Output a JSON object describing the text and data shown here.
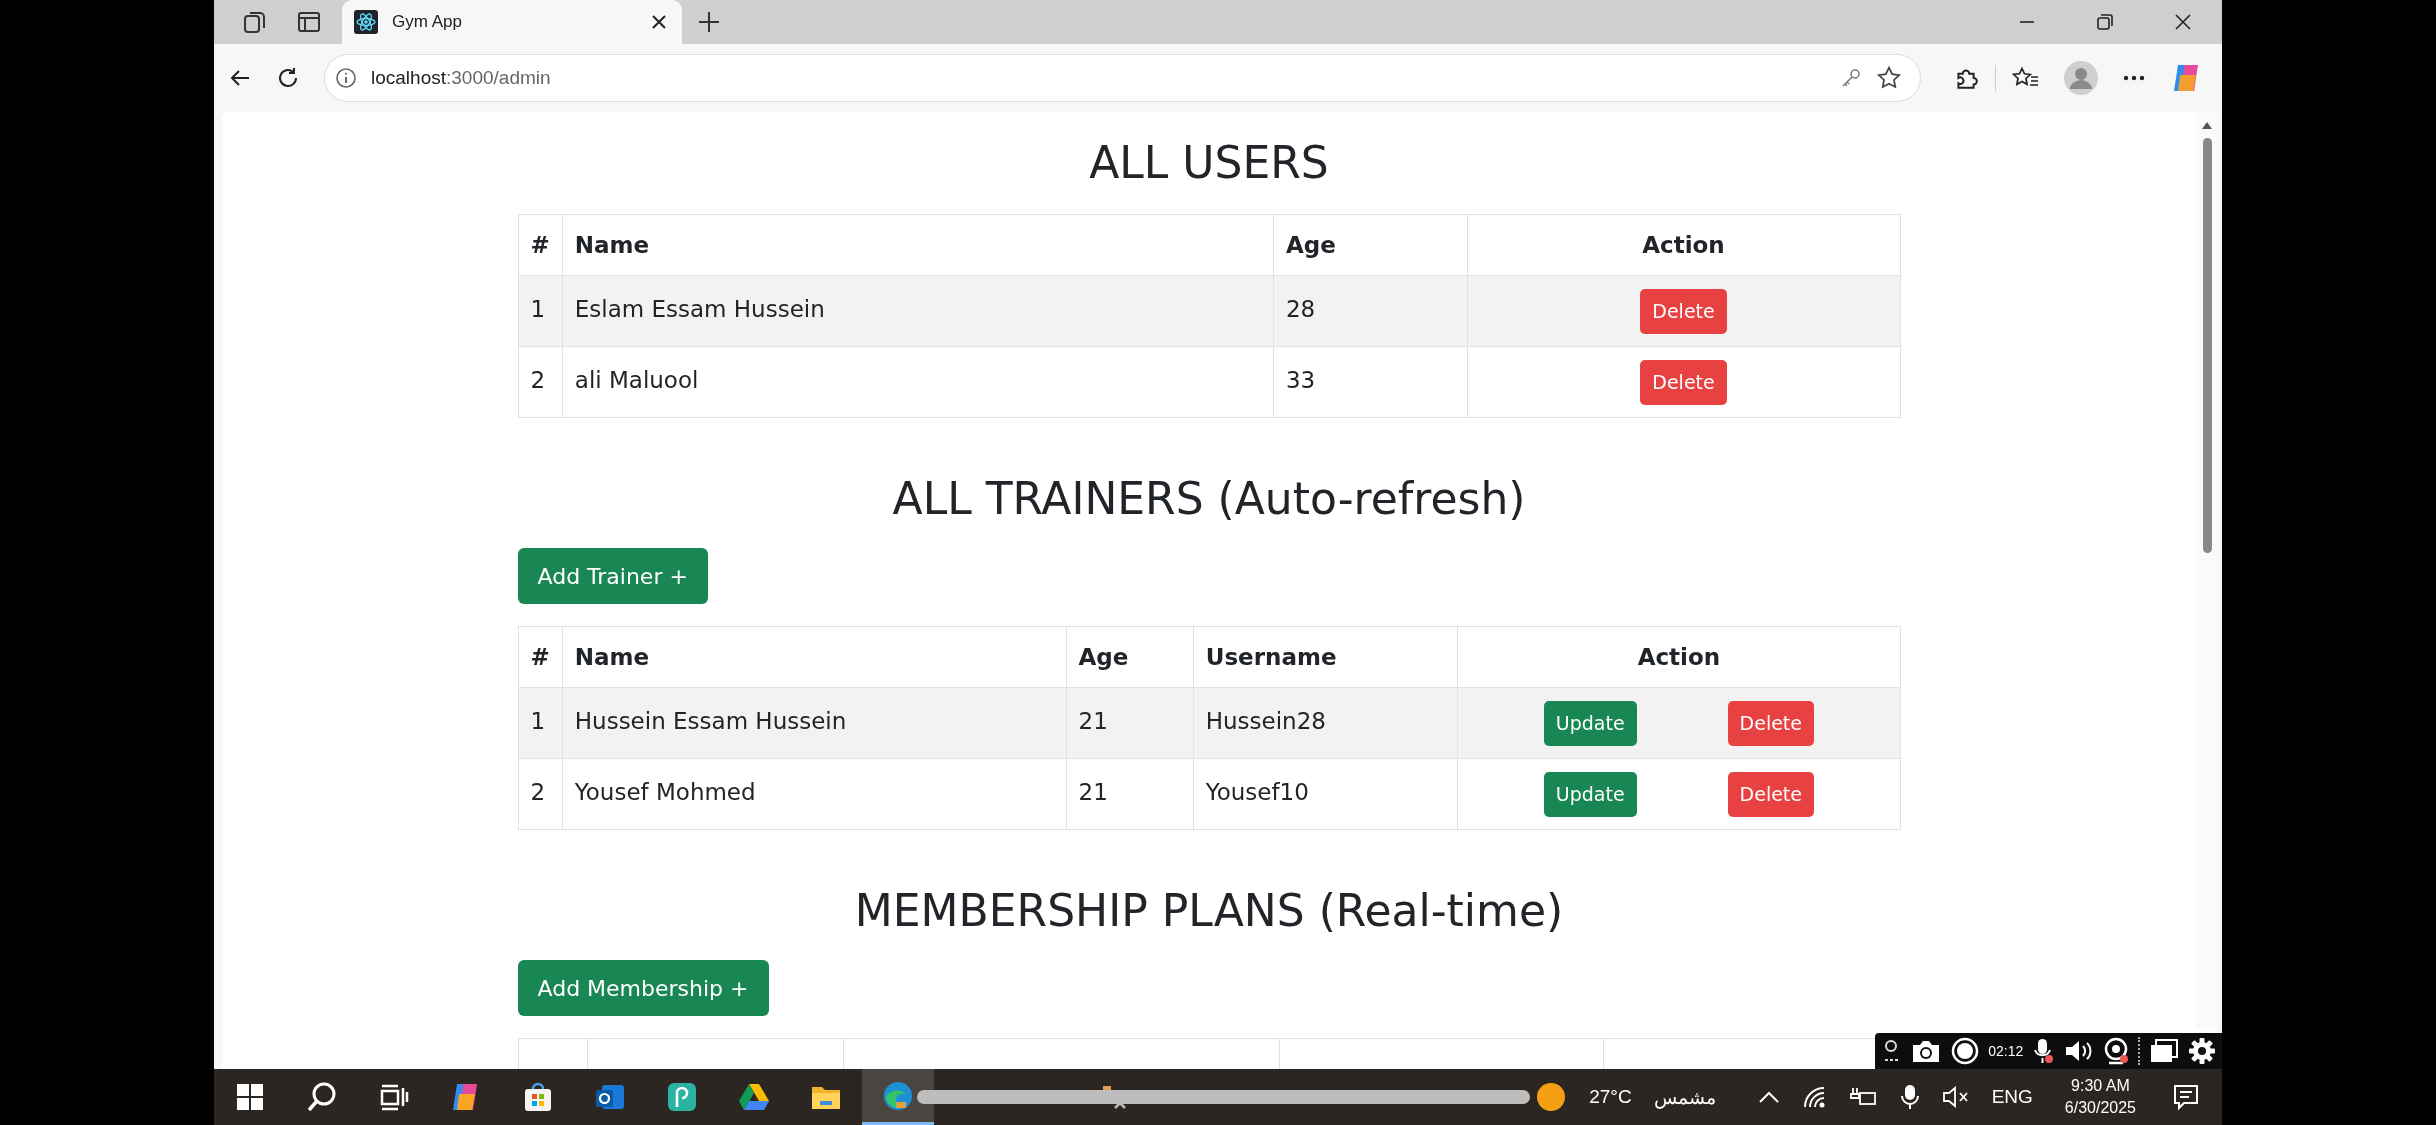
{
  "browser": {
    "tab": {
      "title": "Gym App",
      "selected": true
    },
    "address": {
      "host": "localhost",
      "path": ":3000/admin"
    }
  },
  "sections": [
    {
      "title": "ALL USERS",
      "table": {
        "columns": [
          {
            "label": "#",
            "kind": "text"
          },
          {
            "label": "Name",
            "kind": "text"
          },
          {
            "label": "Age",
            "kind": "text"
          },
          {
            "label": "Action",
            "kind": "action"
          }
        ],
        "rows": [
          {
            "cells": [
              "1",
              "Eslam Essam Hussein",
              "28"
            ],
            "actions": [
              {
                "kind": "delete",
                "label": "Delete"
              }
            ]
          },
          {
            "cells": [
              "2",
              "ali Maluool",
              "33"
            ],
            "actions": [
              {
                "kind": "delete",
                "label": "Delete"
              }
            ]
          }
        ]
      }
    },
    {
      "title": "ALL TRAINERS (Auto-refresh)",
      "add_button": "Add Trainer +",
      "table": {
        "columns": [
          {
            "label": "#",
            "kind": "text"
          },
          {
            "label": "Name",
            "kind": "text"
          },
          {
            "label": "Age",
            "kind": "text"
          },
          {
            "label": "Username",
            "kind": "text"
          },
          {
            "label": "Action",
            "kind": "action"
          }
        ],
        "rows": [
          {
            "cells": [
              "1",
              "Hussein Essam Hussein",
              "21",
              "Hussein28"
            ],
            "actions": [
              {
                "kind": "update",
                "label": "Update"
              },
              {
                "kind": "delete",
                "label": "Delete"
              }
            ]
          },
          {
            "cells": [
              "2",
              "Yousef Mohmed",
              "21",
              "Yousef10"
            ],
            "actions": [
              {
                "kind": "update",
                "label": "Update"
              },
              {
                "kind": "delete",
                "label": "Delete"
              }
            ]
          }
        ]
      }
    },
    {
      "title": "MEMBERSHIP PLANS (Real-time)",
      "add_button": "Add Membership +",
      "table": {
        "cut_off": true
      }
    }
  ],
  "recorder": {
    "elapsed": "02:12"
  },
  "taskbar": {
    "apps": [
      {
        "kind": "windows",
        "active": false
      },
      {
        "kind": "search",
        "active": false
      },
      {
        "kind": "taskview",
        "active": false
      },
      {
        "kind": "copilot",
        "active": false
      },
      {
        "kind": "store",
        "active": false
      },
      {
        "kind": "outlook",
        "active": false
      },
      {
        "kind": "pen",
        "active": false
      },
      {
        "kind": "drive",
        "active": false
      },
      {
        "kind": "folder",
        "active": false
      },
      {
        "kind": "edge",
        "active": true
      },
      {
        "kind": "tool",
        "active": false
      }
    ],
    "weather": {
      "temperature": "27°C",
      "condition": "مشمس"
    },
    "language": "ENG",
    "time": "9:30 AM",
    "date": "6/30/2025"
  }
}
